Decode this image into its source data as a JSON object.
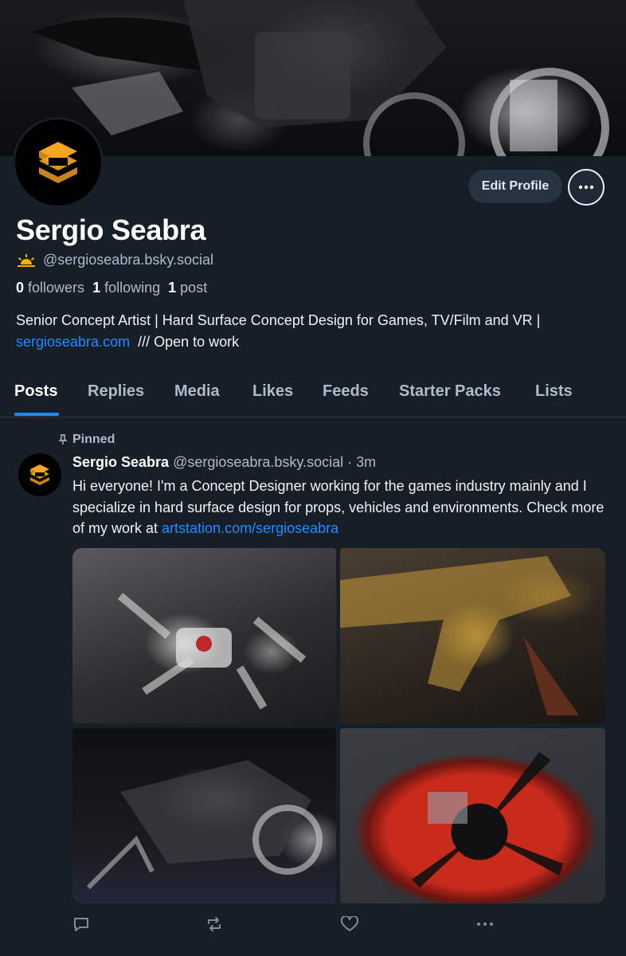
{
  "profile": {
    "display_name": "Sergio Seabra",
    "handle": "@sergioseabra.bsky.social",
    "followers_count": "0",
    "followers_label": "followers",
    "following_count": "1",
    "following_label": "following",
    "posts_count": "1",
    "posts_label": "post",
    "bio_text": "Senior Concept Artist | Hard Surface Concept Design for Games, TV/Film and VR | ",
    "bio_link": "sergioseabra.com",
    "bio_suffix": "  /// Open to work",
    "edit_profile_label": "Edit Profile"
  },
  "tabs": [
    {
      "label": "Posts",
      "active": true
    },
    {
      "label": "Replies"
    },
    {
      "label": "Media"
    },
    {
      "label": "Likes"
    },
    {
      "label": "Feeds"
    },
    {
      "label": "Starter Packs"
    },
    {
      "label": "Lists"
    }
  ],
  "post": {
    "pinned_label": "Pinned",
    "author_name": "Sergio Seabra",
    "author_handle": "@sergioseabra.bsky.social",
    "separator": " · ",
    "time": "3m",
    "text": "Hi everyone! I'm a Concept Designer working for the games industry mainly and I specialize in hard surface design for props, vehicles and environments. Check more of my work at ",
    "link": "artstation.com/sergioseabra"
  },
  "colors": {
    "background": "#161e27",
    "accent": "#208bfe",
    "logo_gold": "#f5a623"
  },
  "icons": [
    "sun-icon",
    "pin-icon",
    "reply-icon",
    "repost-icon",
    "like-icon",
    "more-icon"
  ]
}
